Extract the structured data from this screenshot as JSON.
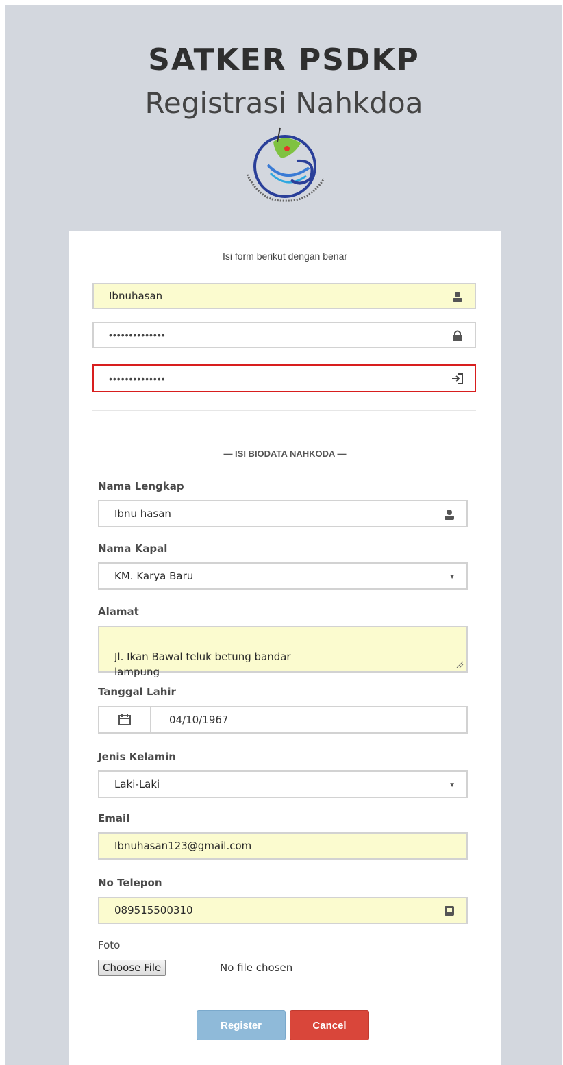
{
  "header": {
    "brand": "SATKER PSDKP",
    "subtitle": "Registrasi Nahkdoa"
  },
  "form": {
    "intro": "Isi form berikut dengan benar",
    "username": "Ibnuhasan",
    "password_masked": "••••••••••••••",
    "confirm_password_masked": "••••••••••••••",
    "section_title": "— ISI BIODATA NAHKODA —",
    "nama_lengkap_label": "Nama Lengkap",
    "nama_lengkap_value": "Ibnu hasan",
    "nama_kapal_label": "Nama Kapal",
    "nama_kapal_value": "KM. Karya Baru",
    "alamat_label": "Alamat",
    "alamat_value": "Jl. Ikan Bawal teluk betung bandar\nlampung",
    "tanggal_lahir_label": "Tanggal Lahir",
    "tanggal_lahir_value": "04/10/1967",
    "jenis_kelamin_label": "Jenis Kelamin",
    "jenis_kelamin_value": "Laki-Laki",
    "email_label": "Email",
    "email_value": "Ibnuhasan123@gmail.com",
    "telepon_label": "No Telepon",
    "telepon_value": "089515500310",
    "foto_label": "Foto",
    "choose_file_label": "Choose File",
    "no_file_text": "No file chosen"
  },
  "actions": {
    "register_label": "Register",
    "cancel_label": "Cancel"
  },
  "colors": {
    "page_bg": "#d3d7de",
    "autofill_bg": "#fbfbcf",
    "error_border": "#d81e1e",
    "register_bg": "#8fbad9",
    "cancel_bg": "#d9463a"
  },
  "icons": [
    "user-icon",
    "lock-icon",
    "login-icon",
    "chevron-down-icon",
    "calendar-icon",
    "phone-icon",
    "logo-icon"
  ]
}
